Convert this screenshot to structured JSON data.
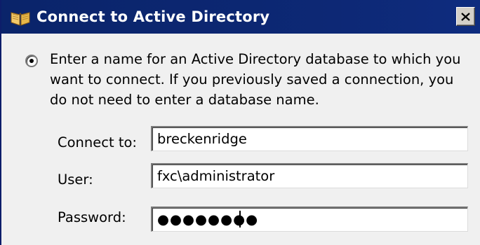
{
  "window": {
    "title": "Connect to Active Directory",
    "close_glyph": "✕"
  },
  "option": {
    "selected": true,
    "description_lines": [
      "Enter a name for an Active Directory database to which you",
      "want to connect. If you previously saved a connection, you",
      "do not need to enter a database name."
    ]
  },
  "form": {
    "connect_to": {
      "label": "Connect to:",
      "value": "breckenridge"
    },
    "user": {
      "label": "User:",
      "value": "fxc\\administrator"
    },
    "password": {
      "label": "Password:",
      "masked_value": "●●●●●●●●"
    }
  },
  "colors": {
    "titlebar": "#0a246a",
    "dialog_bg": "#f0f0f0",
    "icon_book": "#e8b84a"
  },
  "icons": {
    "title_icon": "open-book-icon",
    "close": "close-icon"
  }
}
